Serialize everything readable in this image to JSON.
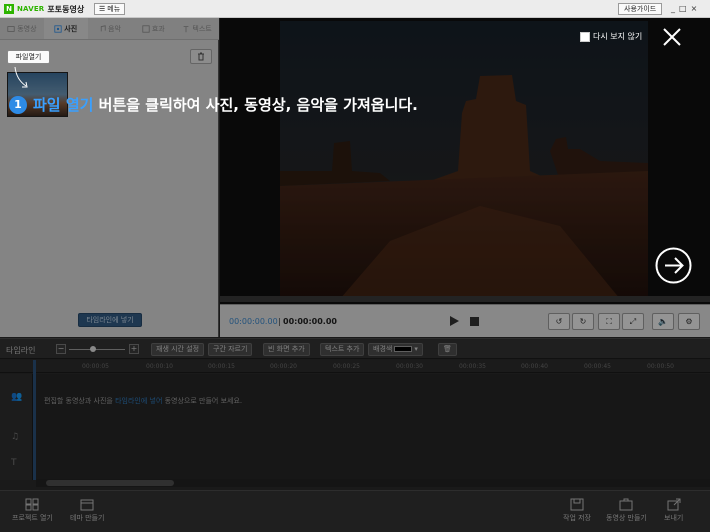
{
  "titlebar": {
    "brand": "NAVER",
    "app_name": "포토동영상",
    "menu_label": "메뉴",
    "guide_label": "사용가이드",
    "controls": [
      "_",
      "□",
      "×"
    ]
  },
  "tabs": [
    {
      "label": "동영상",
      "icon": "video-icon",
      "active": false
    },
    {
      "label": "사진",
      "icon": "photo-icon",
      "active": true
    },
    {
      "label": "음악",
      "icon": "music-icon",
      "active": false
    },
    {
      "label": "효과",
      "icon": "effect-icon",
      "active": false
    },
    {
      "label": "텍스트",
      "icon": "text-icon",
      "active": false
    }
  ],
  "library": {
    "file_open_label": "파일열기",
    "timeline_open_label": "타임라인에 넣기"
  },
  "player": {
    "current_time": "00:00:00.00",
    "separator": "|",
    "total_time": "00:00:00.00"
  },
  "timeline_toolbar": {
    "label": "타임라인",
    "zoom_minus": "−",
    "zoom_plus": "+",
    "buttons": [
      "재생 시간 설정",
      "구간 자르기",
      "빈 화면 추가",
      "텍스트 추가"
    ],
    "bg_color_label": "배경색",
    "bg_color": "#000000"
  },
  "ruler": {
    "ticks": [
      "00:00:05",
      "00:00:10",
      "00:00:15",
      "00:00:20",
      "00:00:25",
      "00:00:30",
      "00:00:35",
      "00:00:40",
      "00:00:45",
      "00:00:50"
    ]
  },
  "tracks": {
    "hint_before": "편집할 동영상과 사진을 ",
    "hint_link": "타임라인에 넣어",
    "hint_after": " 동영상으로 만들어 보세요."
  },
  "bottom_bar": {
    "project_open": "프로젝트 열기",
    "theme_make": "테마 만들기",
    "project_save": "작업 저장",
    "video_make": "동영상 만들기",
    "send": "보내기"
  },
  "guide": {
    "step_number": "1",
    "highlight": "파일 열기",
    "text": " 버튼을 클릭하여 사진, 동영상, 음악을 가져옵니다.",
    "dont_show_label": "다시 보지 않기"
  },
  "colors": {
    "accent": "#2e8be6",
    "naver_green": "#2db400",
    "time_blue": "#3b86c9"
  }
}
